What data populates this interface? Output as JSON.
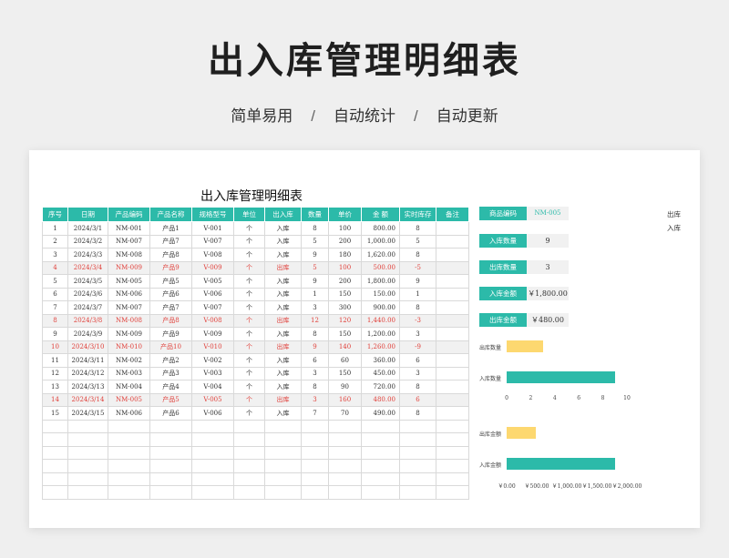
{
  "header": {
    "title": "出入库管理明细表",
    "features": [
      "简单易用",
      "自动统计",
      "自动更新"
    ],
    "separator": "/"
  },
  "sheet": {
    "title": "出入库管理明细表",
    "columns": [
      "序号",
      "日期",
      "产品编码",
      "产品名称",
      "规格型号",
      "单位",
      "出入库",
      "数量",
      "单价",
      "金 额",
      "实时库存",
      "备注"
    ],
    "rows": [
      {
        "no": "1",
        "date": "2024/3/1",
        "code": "NM-001",
        "name": "产品1",
        "spec": "V-001",
        "unit": "个",
        "type": "入库",
        "qty": "8",
        "price": "100",
        "amount": "800.00",
        "stock": "8",
        "note": "",
        "out": false
      },
      {
        "no": "2",
        "date": "2024/3/2",
        "code": "NM-007",
        "name": "产品7",
        "spec": "V-007",
        "unit": "个",
        "type": "入库",
        "qty": "5",
        "price": "200",
        "amount": "1,000.00",
        "stock": "5",
        "note": "",
        "out": false
      },
      {
        "no": "3",
        "date": "2024/3/3",
        "code": "NM-008",
        "name": "产品8",
        "spec": "V-008",
        "unit": "个",
        "type": "入库",
        "qty": "9",
        "price": "180",
        "amount": "1,620.00",
        "stock": "8",
        "note": "",
        "out": false
      },
      {
        "no": "4",
        "date": "2024/3/4",
        "code": "NM-009",
        "name": "产品9",
        "spec": "V-009",
        "unit": "个",
        "type": "出库",
        "qty": "5",
        "price": "100",
        "amount": "500.00",
        "stock": "-5",
        "note": "",
        "out": true
      },
      {
        "no": "5",
        "date": "2024/3/5",
        "code": "NM-005",
        "name": "产品5",
        "spec": "V-005",
        "unit": "个",
        "type": "入库",
        "qty": "9",
        "price": "200",
        "amount": "1,800.00",
        "stock": "9",
        "note": "",
        "out": false
      },
      {
        "no": "6",
        "date": "2024/3/6",
        "code": "NM-006",
        "name": "产品6",
        "spec": "V-006",
        "unit": "个",
        "type": "入库",
        "qty": "1",
        "price": "150",
        "amount": "150.00",
        "stock": "1",
        "note": "",
        "out": false
      },
      {
        "no": "7",
        "date": "2024/3/7",
        "code": "NM-007",
        "name": "产品7",
        "spec": "V-007",
        "unit": "个",
        "type": "入库",
        "qty": "3",
        "price": "300",
        "amount": "900.00",
        "stock": "8",
        "note": "",
        "out": false
      },
      {
        "no": "8",
        "date": "2024/3/8",
        "code": "NM-008",
        "name": "产品8",
        "spec": "V-008",
        "unit": "个",
        "type": "出库",
        "qty": "12",
        "price": "120",
        "amount": "1,440.00",
        "stock": "-3",
        "note": "",
        "out": true
      },
      {
        "no": "9",
        "date": "2024/3/9",
        "code": "NM-009",
        "name": "产品9",
        "spec": "V-009",
        "unit": "个",
        "type": "入库",
        "qty": "8",
        "price": "150",
        "amount": "1,200.00",
        "stock": "3",
        "note": "",
        "out": false
      },
      {
        "no": "10",
        "date": "2024/3/10",
        "code": "NM-010",
        "name": "产品10",
        "spec": "V-010",
        "unit": "个",
        "type": "出库",
        "qty": "9",
        "price": "140",
        "amount": "1,260.00",
        "stock": "-9",
        "note": "",
        "out": true
      },
      {
        "no": "11",
        "date": "2024/3/11",
        "code": "NM-002",
        "name": "产品2",
        "spec": "V-002",
        "unit": "个",
        "type": "入库",
        "qty": "6",
        "price": "60",
        "amount": "360.00",
        "stock": "6",
        "note": "",
        "out": false
      },
      {
        "no": "12",
        "date": "2024/3/12",
        "code": "NM-003",
        "name": "产品3",
        "spec": "V-003",
        "unit": "个",
        "type": "入库",
        "qty": "3",
        "price": "150",
        "amount": "450.00",
        "stock": "3",
        "note": "",
        "out": false
      },
      {
        "no": "13",
        "date": "2024/3/13",
        "code": "NM-004",
        "name": "产品4",
        "spec": "V-004",
        "unit": "个",
        "type": "入库",
        "qty": "8",
        "price": "90",
        "amount": "720.00",
        "stock": "8",
        "note": "",
        "out": false
      },
      {
        "no": "14",
        "date": "2024/3/14",
        "code": "NM-005",
        "name": "产品5",
        "spec": "V-005",
        "unit": "个",
        "type": "出库",
        "qty": "3",
        "price": "160",
        "amount": "480.00",
        "stock": "6",
        "note": "",
        "out": true
      },
      {
        "no": "15",
        "date": "2024/3/15",
        "code": "NM-006",
        "name": "产品6",
        "spec": "V-006",
        "unit": "个",
        "type": "入库",
        "qty": "7",
        "price": "70",
        "amount": "490.00",
        "stock": "8",
        "note": "",
        "out": false
      }
    ],
    "empty_rows": 6
  },
  "summary": {
    "code_label": "商品编码",
    "code_value": "NM-005",
    "in_qty_label": "入库数量",
    "in_qty_value": "9",
    "out_qty_label": "出库数量",
    "out_qty_value": "3",
    "in_amount_label": "入库金额",
    "in_amount_value": "￥1,800.00",
    "out_amount_label": "出库金额",
    "out_amount_value": "￥480.00"
  },
  "legend": [
    "出库",
    "入库"
  ],
  "colors": {
    "teal": "#2cbaa9",
    "yellow": "#fdd870",
    "out_red": "#e0403a"
  },
  "chart_data": [
    {
      "type": "bar",
      "orientation": "horizontal",
      "categories": [
        "出库数量",
        "入库数量"
      ],
      "values": [
        3,
        9
      ],
      "xlim": [
        0,
        10
      ],
      "ticks": [
        "0",
        "2",
        "4",
        "6",
        "8",
        "10"
      ],
      "bar_colors": [
        "#fdd870",
        "#2cbaa9"
      ],
      "grid": false
    },
    {
      "type": "bar",
      "orientation": "horizontal",
      "categories": [
        "出库金额",
        "入库金额"
      ],
      "values": [
        480,
        1800
      ],
      "xlim": [
        0,
        2000
      ],
      "ticks": [
        "￥0.00",
        "￥500.00",
        "￥1,000.00",
        "￥1,500.00",
        "￥2,000.00"
      ],
      "bar_colors": [
        "#fdd870",
        "#2cbaa9"
      ],
      "grid": false
    }
  ]
}
